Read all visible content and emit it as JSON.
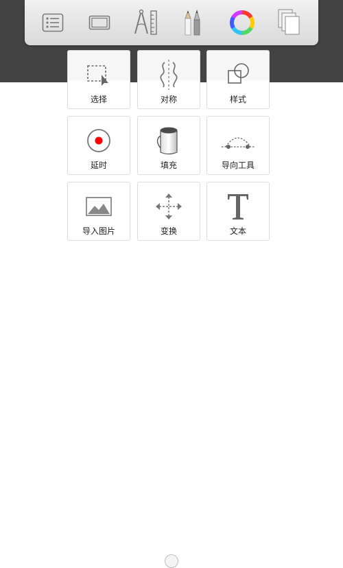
{
  "toolbar": {
    "buttons": [
      {
        "name": "list-icon"
      },
      {
        "name": "canvas-frame-icon"
      },
      {
        "name": "compass-ruler-icon"
      },
      {
        "name": "brushes-icon"
      },
      {
        "name": "color-wheel-icon"
      },
      {
        "name": "layers-icon"
      }
    ]
  },
  "tools": [
    {
      "label": "选择",
      "icon": "selection-icon"
    },
    {
      "label": "对称",
      "icon": "symmetry-icon"
    },
    {
      "label": "样式",
      "icon": "style-shapes-icon"
    },
    {
      "label": "延时",
      "icon": "time-lapse-record-icon"
    },
    {
      "label": "填充",
      "icon": "paint-bucket-icon"
    },
    {
      "label": "导向工具",
      "icon": "guide-curve-icon"
    },
    {
      "label": "导入图片",
      "icon": "image-icon"
    },
    {
      "label": "变换",
      "icon": "transform-arrows-icon"
    },
    {
      "label": "文本",
      "icon": "text-icon"
    }
  ],
  "colors": {
    "dark_band": "#434343",
    "record_dot": "#ff0000"
  }
}
